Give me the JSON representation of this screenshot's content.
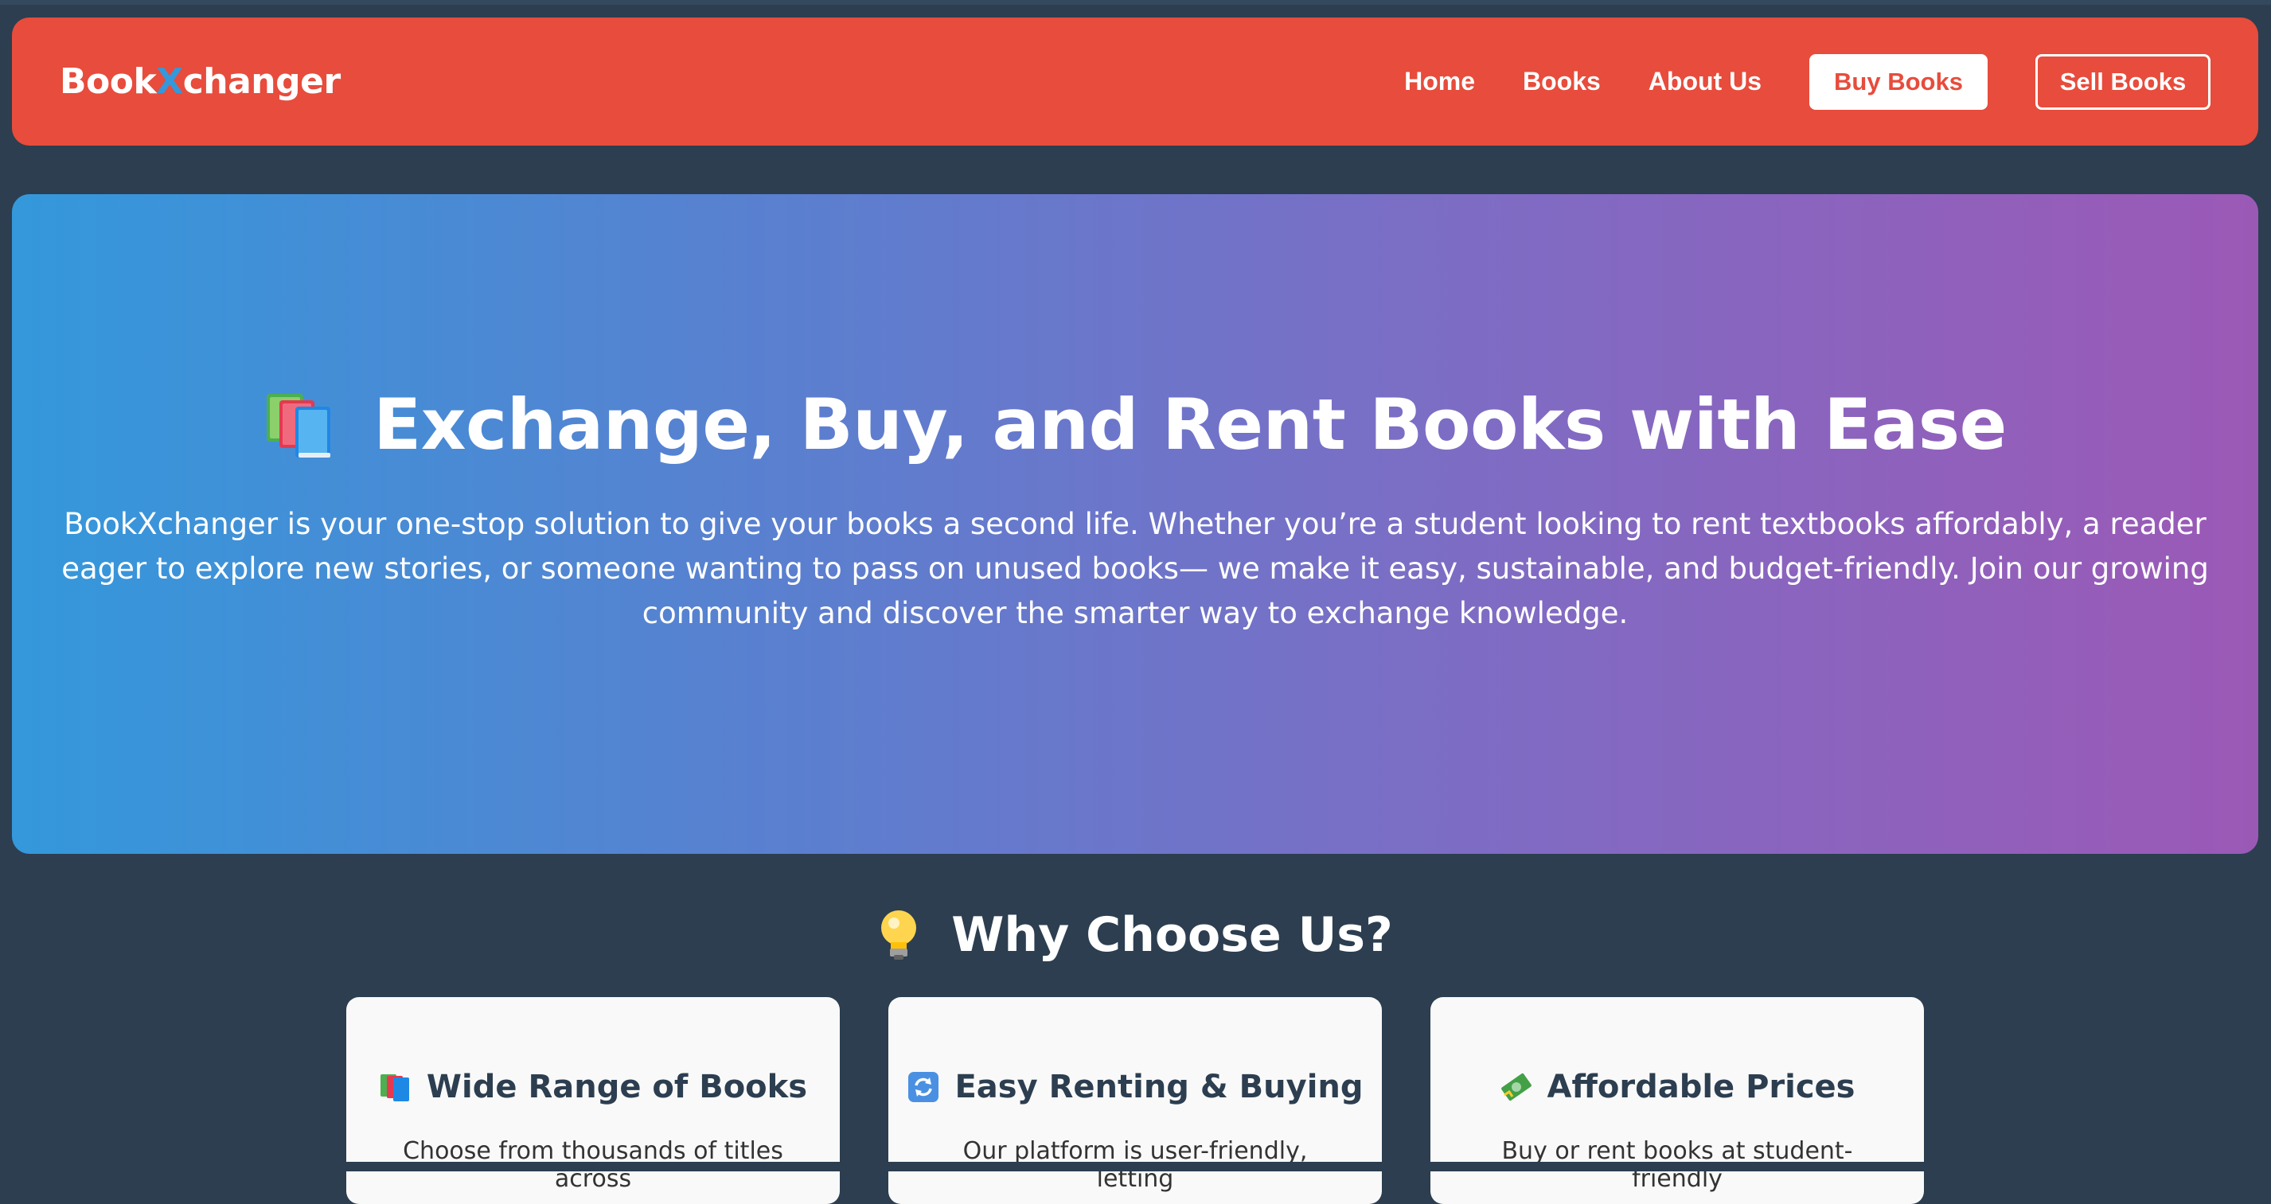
{
  "navbar": {
    "brand_part1": "Book",
    "brand_x": "X",
    "brand_part2": "changer",
    "links": [
      "Home",
      "Books",
      "About Us"
    ],
    "buy_button": "Buy Books",
    "sell_button": "Sell Books"
  },
  "hero": {
    "icon": "books-icon",
    "title": "Exchange, Buy, and Rent Books with Ease",
    "description": "BookXchanger is your one-stop solution to give your books a second life. Whether you’re a student looking to rent textbooks affordably, a reader eager to explore new stories, or someone wanting to pass on unused books— we make it easy, sustainable, and budget-friendly. Join our growing community and discover the smarter way to exchange knowledge."
  },
  "why": {
    "icon": "lightbulb-icon",
    "title": "Why Choose Us?",
    "cards": [
      {
        "icon": "books-icon",
        "title": "Wide Range of Books",
        "text": "Choose from thousands of titles across"
      },
      {
        "icon": "refresh-icon",
        "title": "Easy Renting & Buying",
        "text": "Our platform is user-friendly, letting"
      },
      {
        "icon": "money-icon",
        "title": "Affordable Prices",
        "text": "Buy or rent books at student-friendly"
      }
    ]
  },
  "colors": {
    "navbar": "#e74c3c",
    "background": "#2c3e50",
    "gradient_start": "#3498db",
    "gradient_end": "#9b59b6",
    "brand_x": "#3498db"
  }
}
